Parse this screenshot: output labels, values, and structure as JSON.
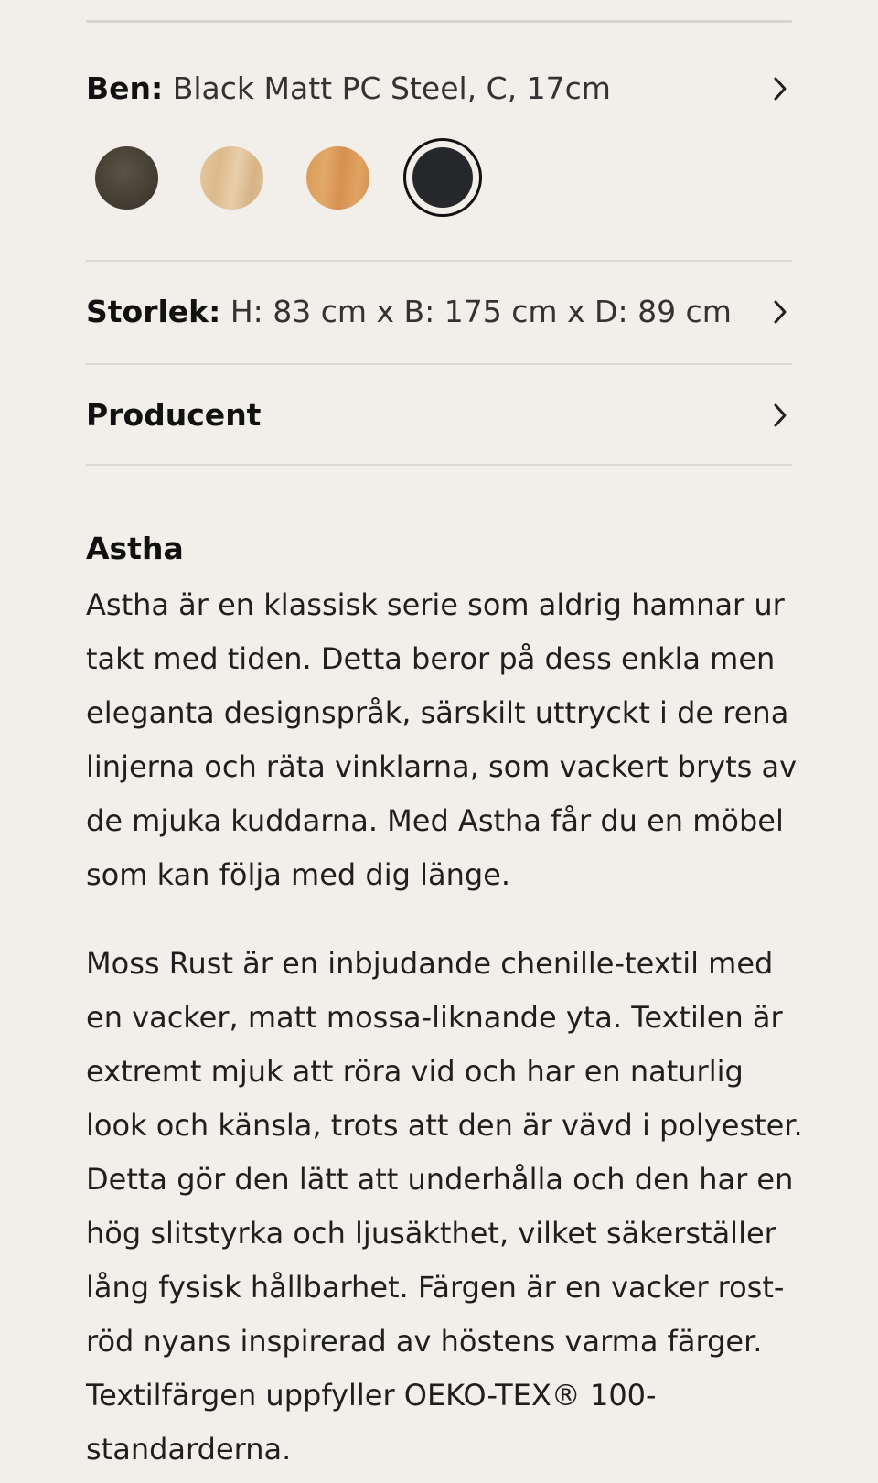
{
  "legs": {
    "label": "Ben:",
    "value": "Black Matt PC Steel, C, 17cm",
    "swatches": [
      {
        "name": "dark-bronze",
        "color": "#47413a",
        "selected": false
      },
      {
        "name": "light-oak",
        "color": "#e0c296",
        "selected": false
      },
      {
        "name": "golden-oak",
        "color": "#dc9e5d",
        "selected": false
      },
      {
        "name": "black-matt",
        "color": "#25272b",
        "selected": true
      }
    ]
  },
  "size": {
    "label": "Storlek:",
    "value": "H: 83 cm x B: 175 cm x D: 89 cm"
  },
  "producer": {
    "label": "Producent"
  },
  "description": {
    "title": "Astha",
    "paragraph1": "Astha är en klassisk serie som aldrig hamnar ur takt med tiden. Detta beror på dess enkla men eleganta designspråk, särskilt uttryckt i de rena linjerna och räta vinklarna, som vackert bryts av de mjuka kuddarna. Med Astha får du en möbel som kan följa med dig länge.",
    "paragraph2": "Moss Rust är en inbjudande chenille-textil med en vacker, matt mossa-liknande yta. Textilen är extremt mjuk att röra vid och har en naturlig look och känsla, trots att den är vävd i polyester. Detta gör den lätt att underhålla och den har en hög slitstyrka och ljusäkthet, vilket säkerställer lång fysisk hållbarhet. Färgen är en vacker rost-röd nyans inspirerad av höstens varma färger. Textilfärgen uppfyller OEKO-TEX® 100-standarderna."
  },
  "colors": {
    "background": "#f2efea",
    "divider": "#dcd9d4",
    "text": "#1d1d1f"
  }
}
